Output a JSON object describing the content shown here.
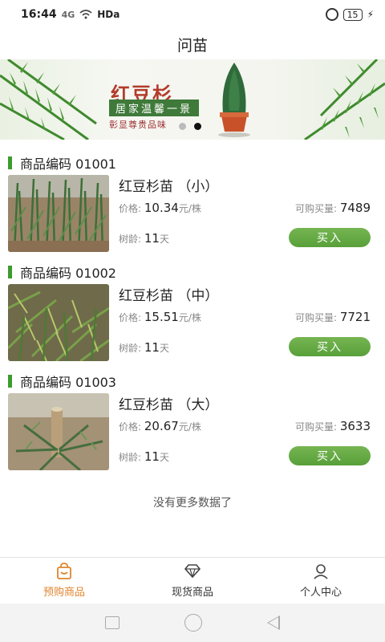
{
  "status_bar": {
    "time": "16:44",
    "signal": "4G",
    "network": "HDa",
    "battery": "15"
  },
  "header": {
    "title": "问苗"
  },
  "banner": {
    "title": "红豆杉",
    "subtitle": "居家温馨一景",
    "tagline": "彰显尊贵品味",
    "slide_count": 2,
    "active_slide": 2
  },
  "products": [
    {
      "code_label": "商品编码 01001",
      "name": "红豆杉苗 （小）",
      "price_label": "价格:",
      "price": "10.34",
      "price_unit": "元/株",
      "stock_label": "可购买量:",
      "stock": "7489",
      "age_label": "树龄:",
      "age": "11",
      "age_unit": "天",
      "buy_label": "买入"
    },
    {
      "code_label": "商品编码 01002",
      "name": "红豆杉苗 （中）",
      "price_label": "价格:",
      "price": "15.51",
      "price_unit": "元/株",
      "stock_label": "可购买量:",
      "stock": "7721",
      "age_label": "树龄:",
      "age": "11",
      "age_unit": "天",
      "buy_label": "买入"
    },
    {
      "code_label": "商品编码 01003",
      "name": "红豆杉苗 （大）",
      "price_label": "价格:",
      "price": "20.67",
      "price_unit": "元/株",
      "stock_label": "可购买量:",
      "stock": "3633",
      "age_label": "树龄:",
      "age": "11",
      "age_unit": "天",
      "buy_label": "买入"
    }
  ],
  "footer_note": "没有更多数据了",
  "tabs": [
    {
      "label": "预购商品",
      "icon": "shopping-bag-icon",
      "active": true
    },
    {
      "label": "现货商品",
      "icon": "diamond-icon",
      "active": false
    },
    {
      "label": "个人中心",
      "icon": "user-icon",
      "active": false
    }
  ],
  "colors": {
    "accent_green": "#58a03a",
    "active_tab": "#e0852e",
    "banner_title": "#b33b2a"
  }
}
